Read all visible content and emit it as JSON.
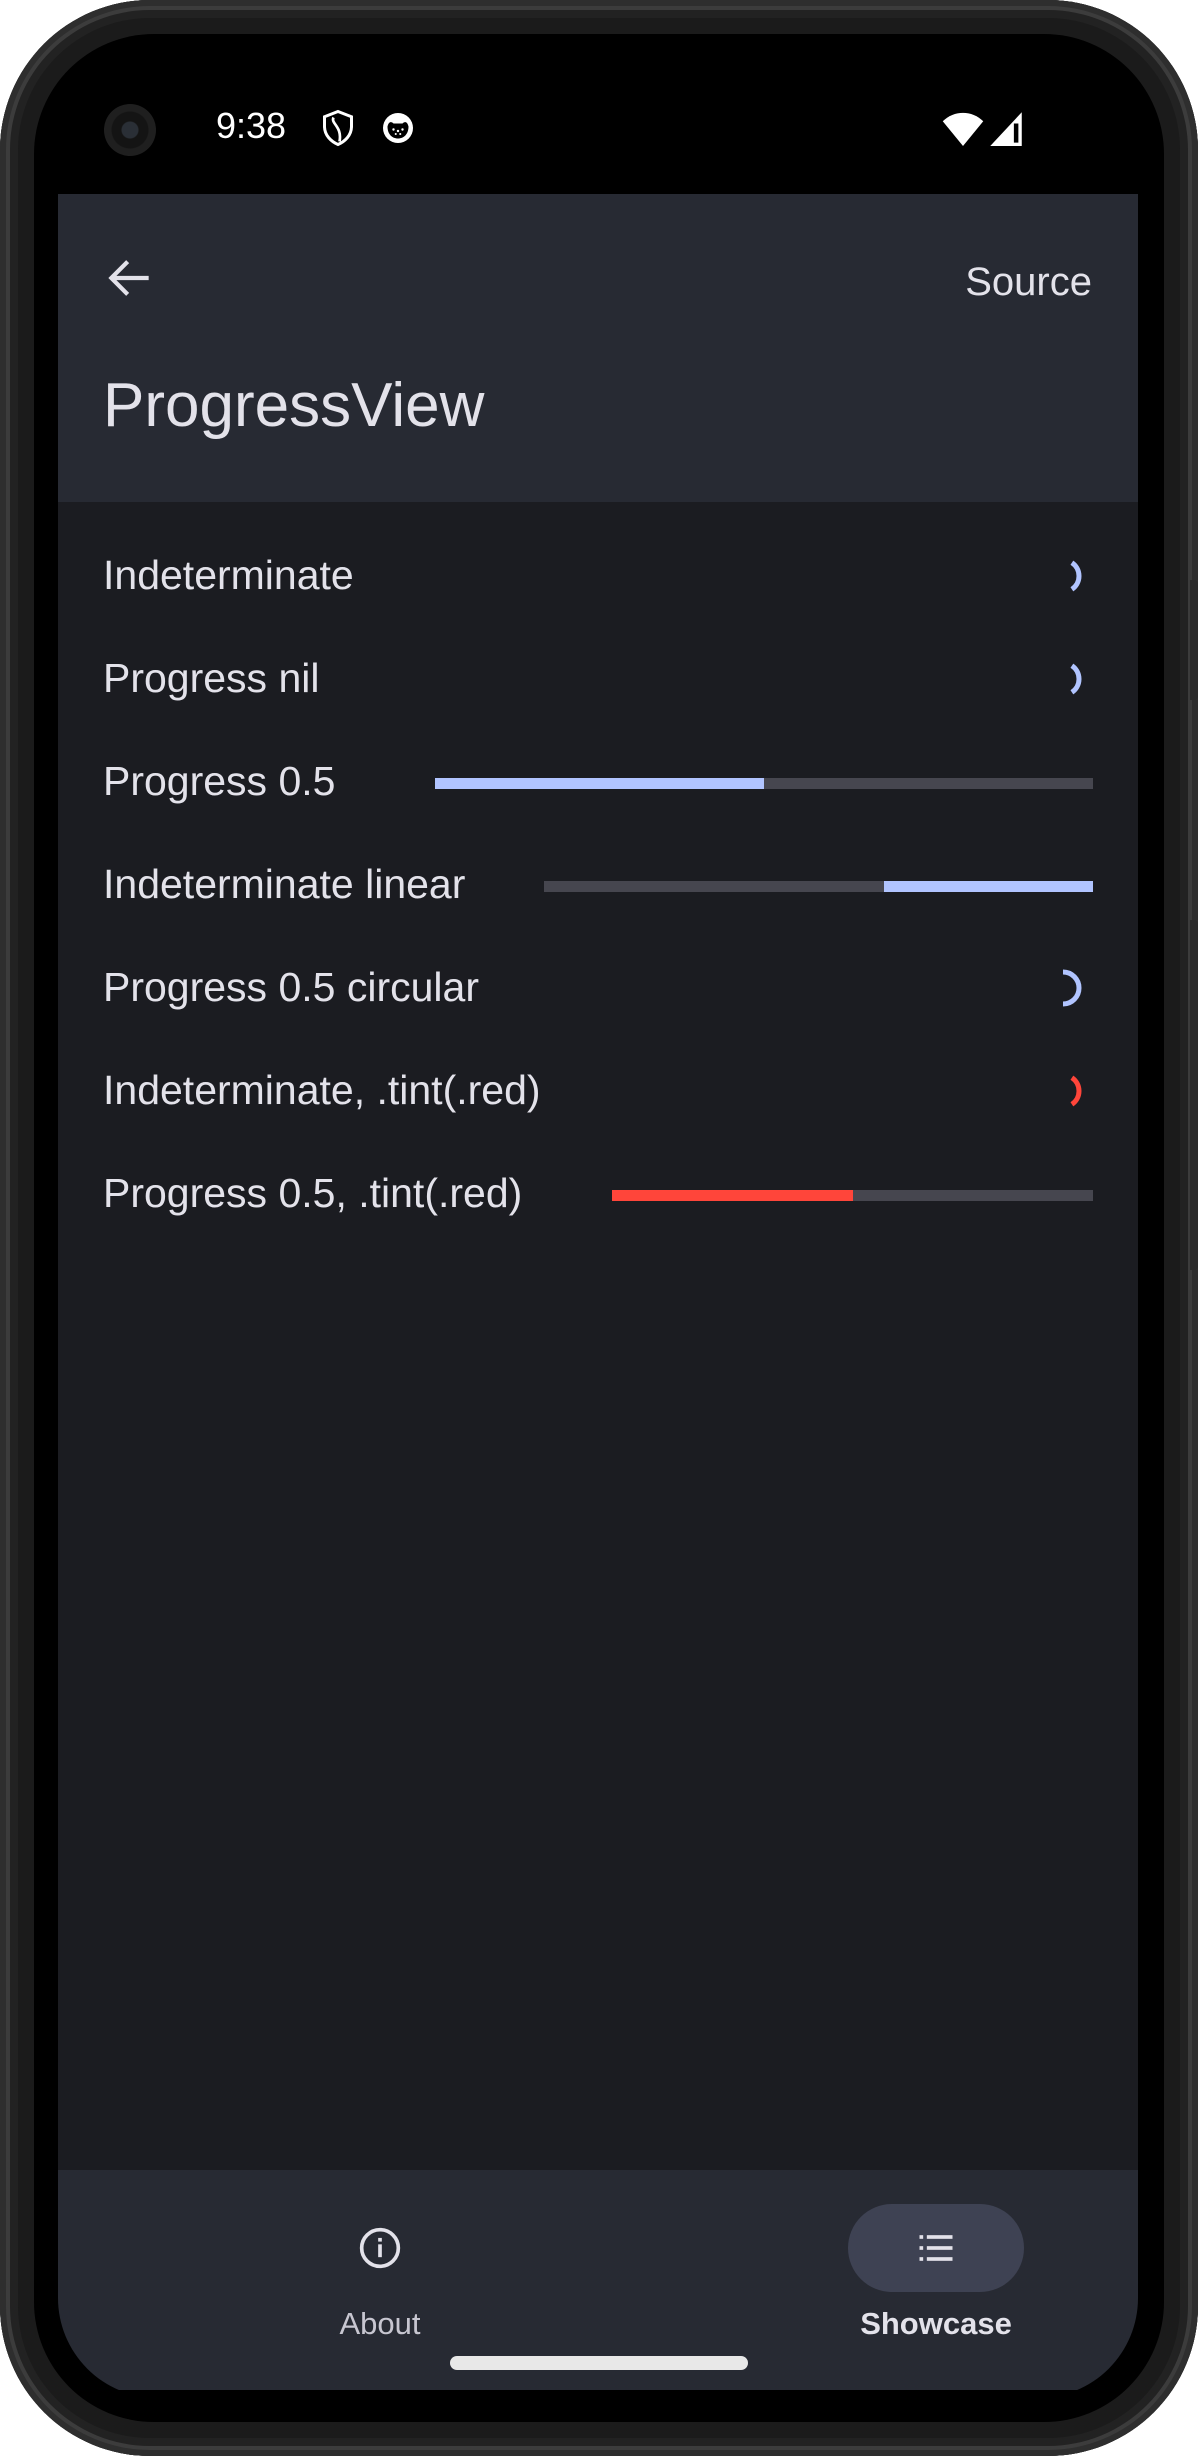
{
  "status_bar": {
    "time": "9:38",
    "icons": [
      "shield-icon",
      "cat-icon",
      "wifi-icon",
      "signal-icon"
    ]
  },
  "app_bar": {
    "back_icon": "arrow-back-icon",
    "action_label": "Source",
    "title": "ProgressView"
  },
  "colors": {
    "accent": "#b1c4ff",
    "red": "#ff453a",
    "track": "#46464f",
    "background": "#1b1c21",
    "surface": "#272a33",
    "text": "#e3e2ea"
  },
  "rows": [
    {
      "label": "Indeterminate",
      "kind": "spinner",
      "tint": "accent"
    },
    {
      "label": "Progress nil",
      "kind": "spinner",
      "tint": "accent"
    },
    {
      "label": "Progress 0.5",
      "kind": "linear",
      "progress": 0.5,
      "tint": "accent"
    },
    {
      "label": "Indeterminate linear",
      "kind": "linear-indeterminate",
      "segment_start": 0.62,
      "segment_end": 1.0,
      "tint": "accent"
    },
    {
      "label": "Progress 0.5 circular",
      "kind": "circular",
      "progress": 0.5,
      "tint": "accent"
    },
    {
      "label": "Indeterminate, .tint(.red)",
      "kind": "spinner",
      "tint": "red"
    },
    {
      "label": "Progress 0.5, .tint(.red)",
      "kind": "linear",
      "progress": 0.5,
      "tint": "red"
    }
  ],
  "bottom_nav": {
    "items": [
      {
        "label": "About",
        "icon": "info-icon",
        "selected": false
      },
      {
        "label": "Showcase",
        "icon": "list-icon",
        "selected": true
      }
    ]
  }
}
